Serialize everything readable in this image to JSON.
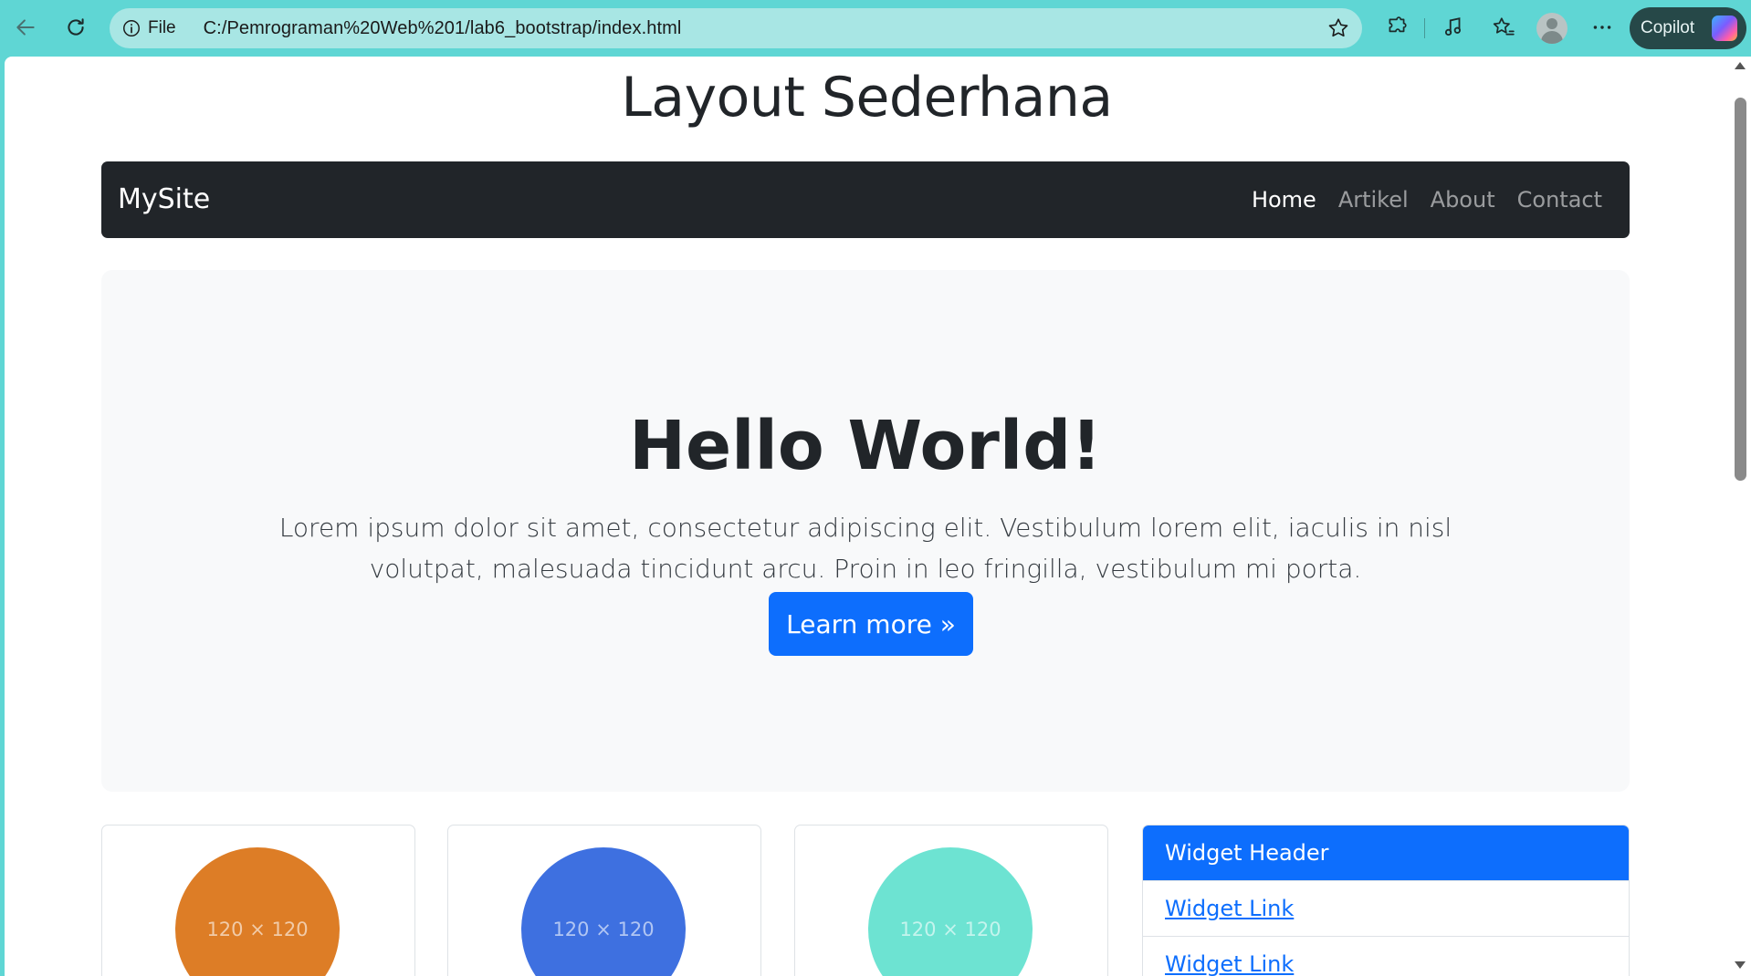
{
  "browser": {
    "file_label": "File",
    "url": "C:/Pemrograman%20Web%201/lab6_bootstrap/index.html",
    "copilot_label": "Copilot"
  },
  "page": {
    "title": "Layout Sederhana"
  },
  "navbar": {
    "brand": "MySite",
    "links": [
      {
        "label": "Home",
        "active": true
      },
      {
        "label": "Artikel",
        "active": false
      },
      {
        "label": "About",
        "active": false
      },
      {
        "label": "Contact",
        "active": false
      }
    ]
  },
  "hero": {
    "title": "Hello World!",
    "text": "Lorem ipsum dolor sit amet, consectetur adipiscing elit. Vestibulum lorem elit, iaculis in nisl volutpat, malesuada tincidunt arcu. Proin in leo fringilla, vestibulum mi porta.",
    "button_label": "Learn more »"
  },
  "cards": [
    {
      "placeholder": "120 × 120",
      "color": "#dd7d26"
    },
    {
      "placeholder": "120 × 120",
      "color": "#3e70e0"
    },
    {
      "placeholder": "120 × 120",
      "color": "#6de3d2"
    }
  ],
  "widget": {
    "header": "Widget Header",
    "links": [
      "Widget Link",
      "Widget Link"
    ]
  },
  "colors": {
    "primary": "#0d6efd",
    "navbar_bg": "#212529",
    "hero_bg": "#f8f9fa",
    "browser_chrome": "#5fd6d4"
  }
}
